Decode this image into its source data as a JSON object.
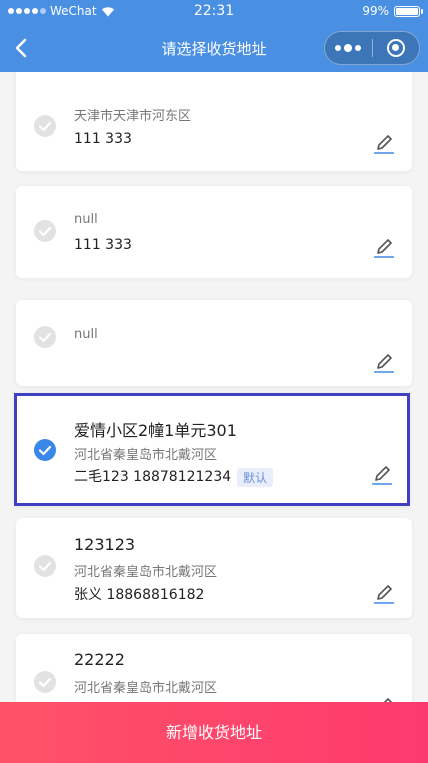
{
  "status_bar": {
    "carrier": "WeChat",
    "time": "22:31",
    "battery": "99%",
    "battery_level": 0.99
  },
  "nav": {
    "title": "请选择收货地址",
    "back_icon": "chevron-left-icon",
    "more_icon": "more-dots-icon",
    "close_icon": "mini-close-icon"
  },
  "addresses": [
    {
      "title": "",
      "region": "天津市天津市河东区",
      "contact": "111 333",
      "selected": false,
      "default": false
    },
    {
      "title": "",
      "region": "null",
      "contact": "111 333",
      "selected": false,
      "default": false
    },
    {
      "title": "",
      "region": "null",
      "contact": "",
      "selected": false,
      "default": false
    },
    {
      "title": "爱情小区2幢1单元301",
      "region": "河北省秦皇岛市北戴河区",
      "contact": "二毛123 18878121234",
      "selected": true,
      "default": true,
      "default_label": "默认"
    },
    {
      "title": "123123",
      "region": "河北省秦皇岛市北戴河区",
      "contact": "张义 18868816182",
      "selected": false,
      "default": false
    },
    {
      "title": "22222",
      "region": "河北省秦皇岛市北戴河区",
      "contact": "",
      "selected": false,
      "default": false
    }
  ],
  "add_button": {
    "label": "新增收货地址"
  },
  "colors": {
    "nav_bg": "#4a90e2",
    "accent": "#3b87e8",
    "add_button": "#ff4a6a",
    "selected_border": "#4040c0"
  }
}
